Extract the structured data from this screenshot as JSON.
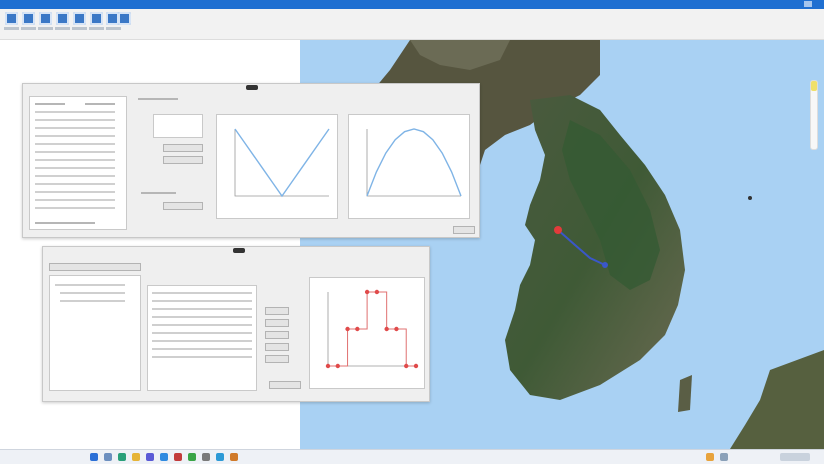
{
  "app": {
    "title": ""
  },
  "toolbar": {
    "buttons": [
      "",
      "",
      "",
      "",
      "",
      "",
      "",
      ""
    ]
  },
  "map": {
    "view": "satellite",
    "region": "korean-peninsula",
    "route_color": "#3a57c9",
    "marker_color": "#e23b3b"
  },
  "window_top": {
    "chart_left": {
      "title": "",
      "xlabel": ""
    },
    "chart_right": {
      "title": "",
      "xlabel": ""
    }
  },
  "window_bottom": {
    "chart": {
      "title": "",
      "xlabel": ""
    }
  },
  "chart_data": [
    {
      "type": "line",
      "title": "",
      "series": [
        {
          "values": [
            1.0,
            0.8,
            0.6,
            0.4,
            0.2,
            0.0,
            0.2,
            0.4,
            0.6,
            0.8,
            1.0
          ]
        }
      ]
    },
    {
      "type": "line",
      "title": "",
      "series": [
        {
          "values": [
            0.0,
            0.36,
            0.64,
            0.84,
            0.96,
            1.0,
            0.96,
            0.84,
            0.64,
            0.36,
            0.0
          ]
        }
      ]
    },
    {
      "type": "line",
      "title": "",
      "series": [
        {
          "values": [
            0,
            0,
            1,
            1,
            2,
            2,
            1,
            1,
            0,
            0
          ]
        }
      ]
    }
  ],
  "colors": {
    "accent": "#1f6fd1",
    "curve": "#7fb4e6",
    "point": "#e04a4a"
  },
  "taskbar": {
    "icons": [
      "start-icon",
      "search-icon",
      "edge-icon",
      "folder-icon",
      "store-icon",
      "mail-icon",
      "app-icon"
    ]
  }
}
